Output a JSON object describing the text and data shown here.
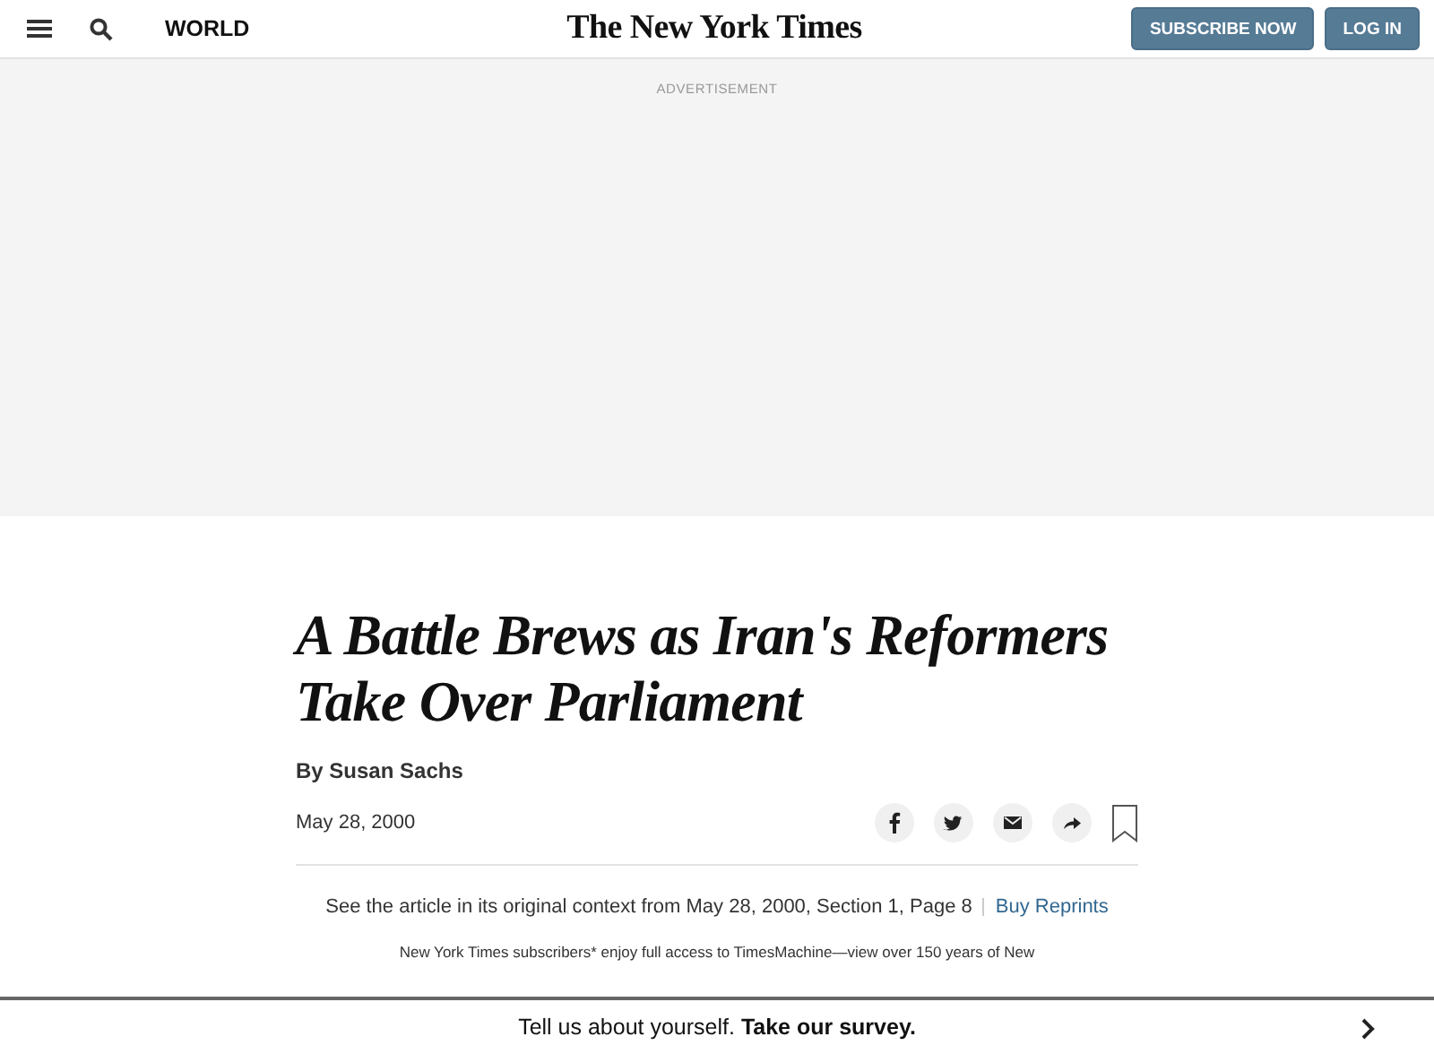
{
  "header": {
    "section": "WORLD",
    "logo": "The New York Times",
    "buttons": [
      "SUBSCRIBE NOW",
      "LOG IN"
    ]
  },
  "ad": {
    "label": "ADVERTISEMENT"
  },
  "article": {
    "headline": "A Battle Brews as Iran's Reformers Take Over Parliament",
    "byline": "By Susan Sachs",
    "date": "May 28, 2000",
    "share": [
      {
        "kind": "facebook"
      },
      {
        "kind": "twitter"
      },
      {
        "kind": "email"
      },
      {
        "kind": "share"
      },
      {
        "kind": "bookmark"
      }
    ],
    "context": "See the article in its original context from May 28, 2000, Section 1, Page 8",
    "reprints": "Buy Reprints",
    "note": "New York Times subscribers* enjoy full access to TimesMachine—view over 150 years of New"
  },
  "survey": {
    "text": "Tell us about yourself. **Take our survey.**"
  }
}
